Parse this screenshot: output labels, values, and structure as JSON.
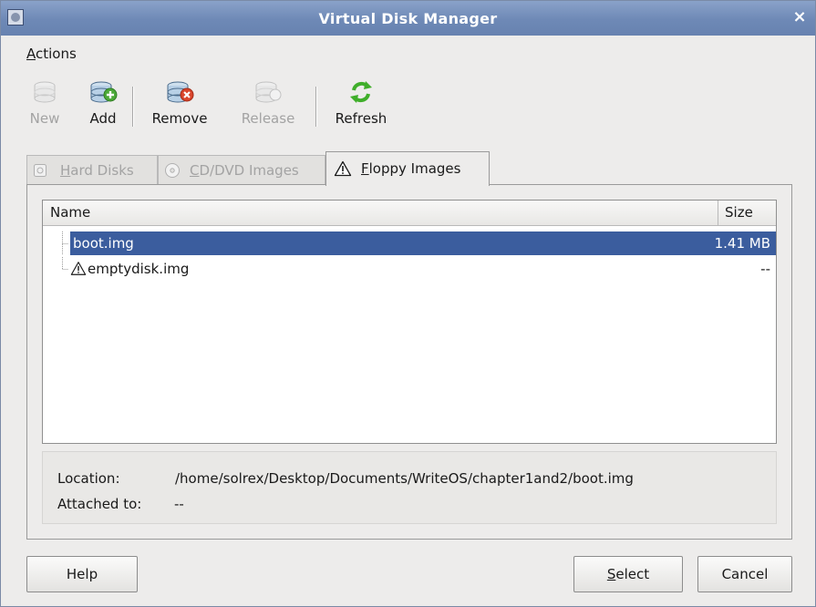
{
  "window": {
    "title": "Virtual Disk Manager",
    "close_glyph": "×"
  },
  "menubar": {
    "actions": {
      "mnemonic": "A",
      "rest": "ctions"
    }
  },
  "toolbar": {
    "new": {
      "label": "New",
      "icon": "new-disk-icon",
      "enabled": false
    },
    "add": {
      "label": "Add",
      "icon": "add-disk-icon",
      "enabled": true
    },
    "remove": {
      "label": "Remove",
      "icon": "remove-disk-icon",
      "enabled": true
    },
    "release": {
      "label": "Release",
      "icon": "release-disk-icon",
      "enabled": false
    },
    "refresh": {
      "label": "Refresh",
      "icon": "refresh-icon",
      "enabled": true
    }
  },
  "tabs": {
    "hard_disks": {
      "mnemonic": "H",
      "rest": "ard Disks",
      "active": false,
      "icon": "hard-disk-icon"
    },
    "cd_dvd": {
      "mnemonic": "C",
      "rest": "D/DVD Images",
      "active": false,
      "icon": "cd-dvd-icon"
    },
    "floppy": {
      "mnemonic": "F",
      "rest": "loppy Images",
      "active": true,
      "icon": "warning-icon"
    }
  },
  "list": {
    "columns": {
      "name": "Name",
      "size": "Size"
    },
    "rows": [
      {
        "name": "boot.img",
        "size": "1.41 MB",
        "selected": true,
        "warning": false
      },
      {
        "name": "emptydisk.img",
        "size": "--",
        "selected": false,
        "warning": true
      }
    ]
  },
  "info": {
    "location_label": "Location:",
    "location_value": "/home/solrex/Desktop/Documents/WriteOS/chapter1and2/boot.img",
    "attached_label": "Attached to:",
    "attached_value": "--"
  },
  "buttons": {
    "help": "Help",
    "select": {
      "mnemonic": "S",
      "rest": "elect"
    },
    "cancel": "Cancel"
  },
  "colors": {
    "titlebar": "#6e89b6",
    "selection": "#3b5d9e",
    "window_bg": "#edeceb",
    "disabled_text": "#a3a3a3",
    "refresh_green": "#3fae2a"
  }
}
